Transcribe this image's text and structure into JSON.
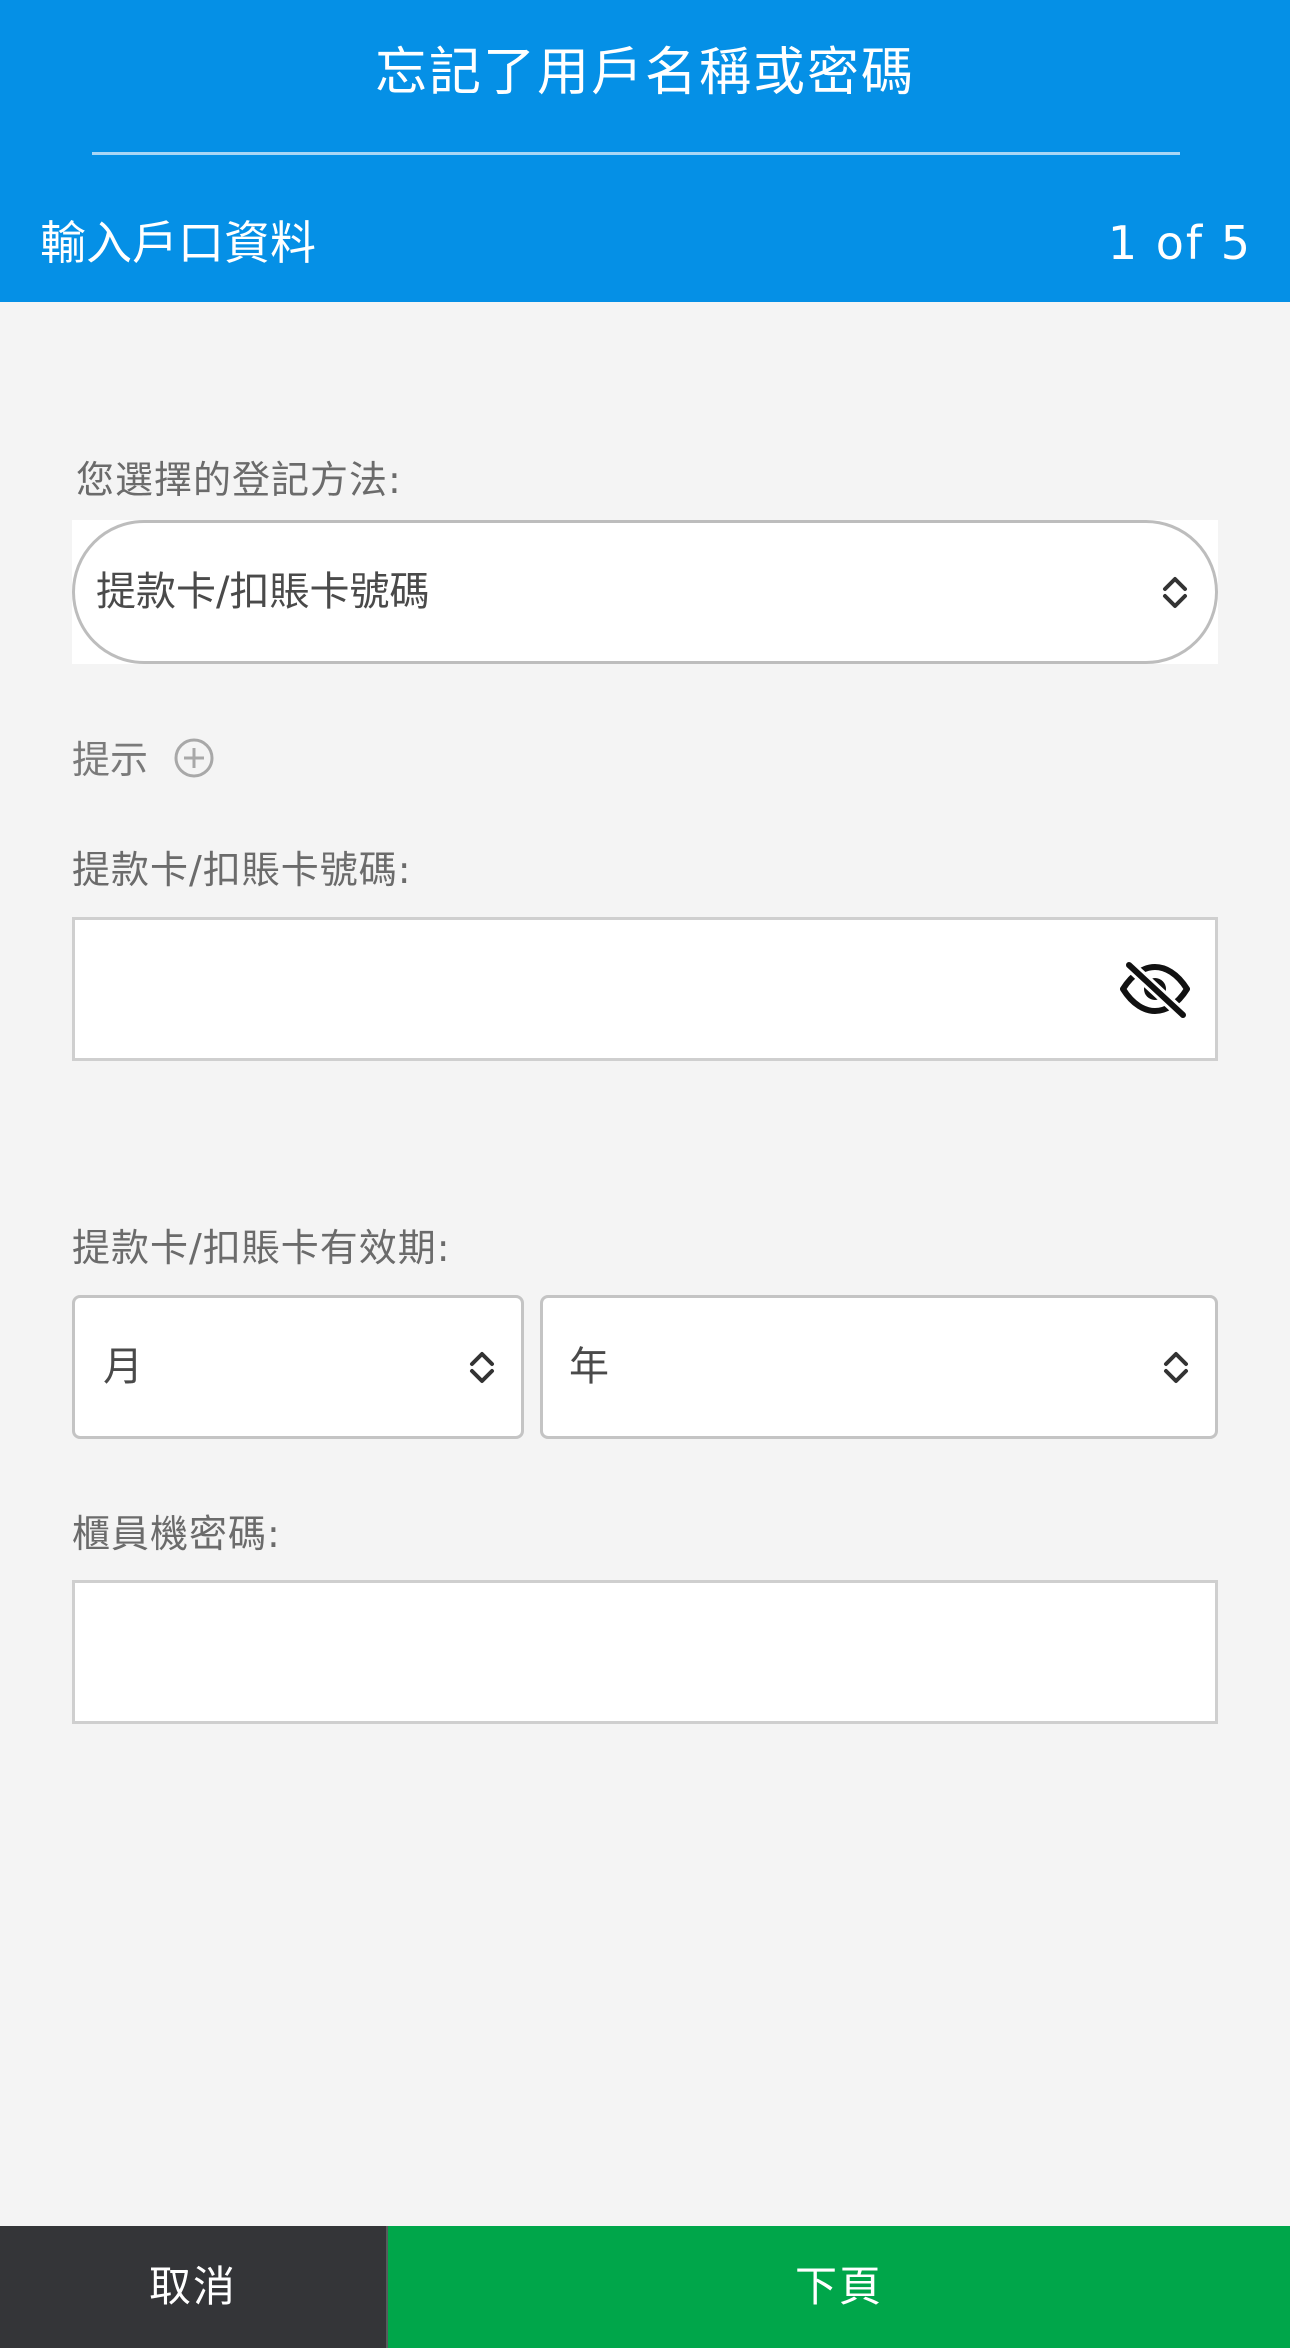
{
  "header": {
    "title": "忘記了用戶名稱或密碼",
    "step_label": "輸入戶口資料",
    "step_count": "1 of 5",
    "background_color": "#0590e6"
  },
  "form": {
    "method_label": "您選擇的登記方法:",
    "method_value": "提款卡/扣賬卡號碼",
    "hint_label": "提示",
    "card_number_label": "提款卡/扣賬卡號碼:",
    "card_number_value": "",
    "expiry_label": "提款卡/扣賬卡有效期:",
    "month_value": "月",
    "year_value": "年",
    "pin_label": "櫃員機密碼:",
    "pin_value": ""
  },
  "icons": {
    "select_chevron": "chevron-up-down-icon",
    "hint_expand": "plus-circle-icon",
    "visibility_toggle": "eye-off-icon"
  },
  "footer": {
    "cancel_label": "取消",
    "next_label": "下頁",
    "cancel_color": "#343538",
    "next_color": "#00a64a"
  }
}
